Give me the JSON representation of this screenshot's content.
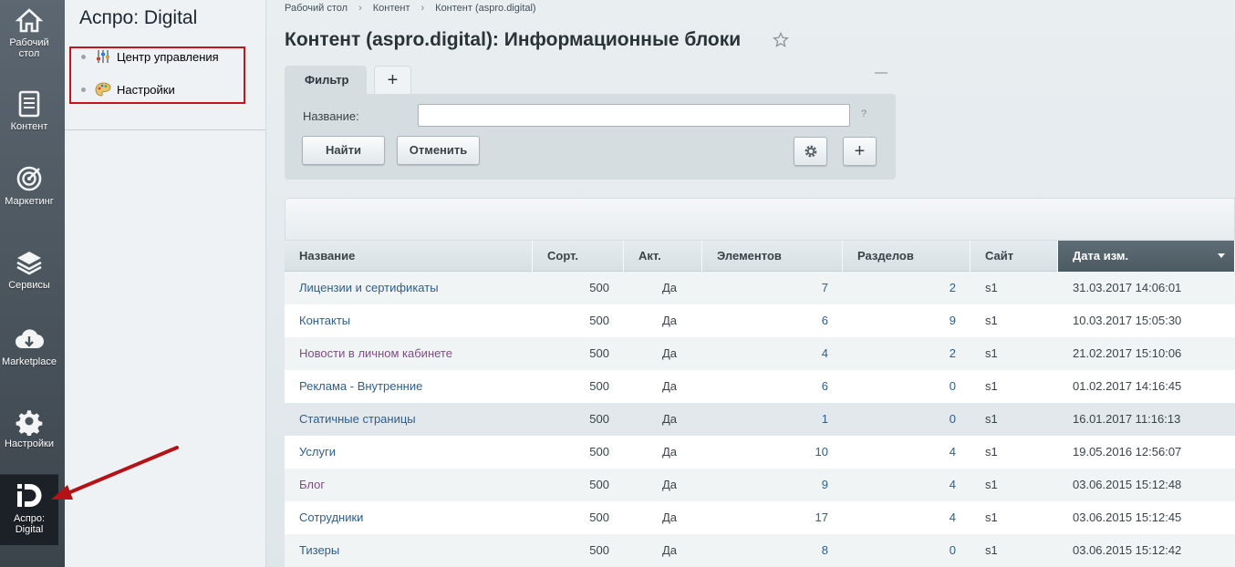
{
  "leftbar": {
    "items": [
      {
        "label": "Рабочий стол",
        "icon": "home-icon"
      },
      {
        "label": "Контент",
        "icon": "document-icon"
      },
      {
        "label": "Маркетинг",
        "icon": "target-icon"
      },
      {
        "label": "Сервисы",
        "icon": "layers-icon"
      },
      {
        "label": "Marketplace",
        "icon": "cloud-download-icon"
      },
      {
        "label": "Настройки",
        "icon": "gear-icon"
      },
      {
        "label": "Аспро: Digital",
        "icon": "aspro-digital-logo"
      }
    ]
  },
  "submenu": {
    "title": "Аспро: Digital",
    "items": [
      {
        "label": "Центр управления",
        "icon": "sliders-icon"
      },
      {
        "label": "Настройки",
        "icon": "palette-icon"
      }
    ]
  },
  "breadcrumbs": [
    "Рабочий стол",
    "Контент",
    "Контент (aspro.digital)"
  ],
  "page_title": "Контент (aspro.digital): Информационные блоки",
  "filter": {
    "tab_label": "Фильтр",
    "add_tab": "+",
    "field_label": "Название:",
    "field_value": "",
    "help": "?",
    "find_label": "Найти",
    "cancel_label": "Отменить",
    "plus_label": "+"
  },
  "table": {
    "columns": [
      "Название",
      "Сорт.",
      "Акт.",
      "Элементов",
      "Разделов",
      "Сайт",
      "Дата изм."
    ],
    "sorted_column": "Дата изм.",
    "rows": [
      {
        "name": "Лицензии и сертификаты",
        "sort": "500",
        "active": "Да",
        "elements": "7",
        "sections": "2",
        "site": "s1",
        "date": "31.03.2017 14:06:01"
      },
      {
        "name": "Контакты",
        "sort": "500",
        "active": "Да",
        "elements": "6",
        "sections": "9",
        "site": "s1",
        "date": "10.03.2017 15:05:30"
      },
      {
        "name": "Новости в личном кабинете",
        "sort": "500",
        "active": "Да",
        "elements": "4",
        "sections": "2",
        "site": "s1",
        "date": "21.02.2017 15:10:06"
      },
      {
        "name": "Реклама - Внутренние",
        "sort": "500",
        "active": "Да",
        "elements": "6",
        "sections": "0",
        "site": "s1",
        "date": "01.02.2017 14:16:45"
      },
      {
        "name": "Статичные страницы",
        "sort": "500",
        "active": "Да",
        "elements": "1",
        "sections": "0",
        "site": "s1",
        "date": "16.01.2017 11:16:13"
      },
      {
        "name": "Услуги",
        "sort": "500",
        "active": "Да",
        "elements": "10",
        "sections": "4",
        "site": "s1",
        "date": "19.05.2016 12:56:07"
      },
      {
        "name": "Блог",
        "sort": "500",
        "active": "Да",
        "elements": "9",
        "sections": "4",
        "site": "s1",
        "date": "03.06.2015 15:12:48"
      },
      {
        "name": "Сотрудники",
        "sort": "500",
        "active": "Да",
        "elements": "17",
        "sections": "4",
        "site": "s1",
        "date": "03.06.2015 15:12:45"
      },
      {
        "name": "Тизеры",
        "sort": "500",
        "active": "Да",
        "elements": "8",
        "sections": "0",
        "site": "s1",
        "date": "03.06.2015 15:12:42"
      }
    ]
  },
  "colors": {
    "highlight_box": "#c3161c",
    "arrow": "#b51218",
    "link": "#2d5e8e",
    "visited_link": "#7e4e87"
  }
}
